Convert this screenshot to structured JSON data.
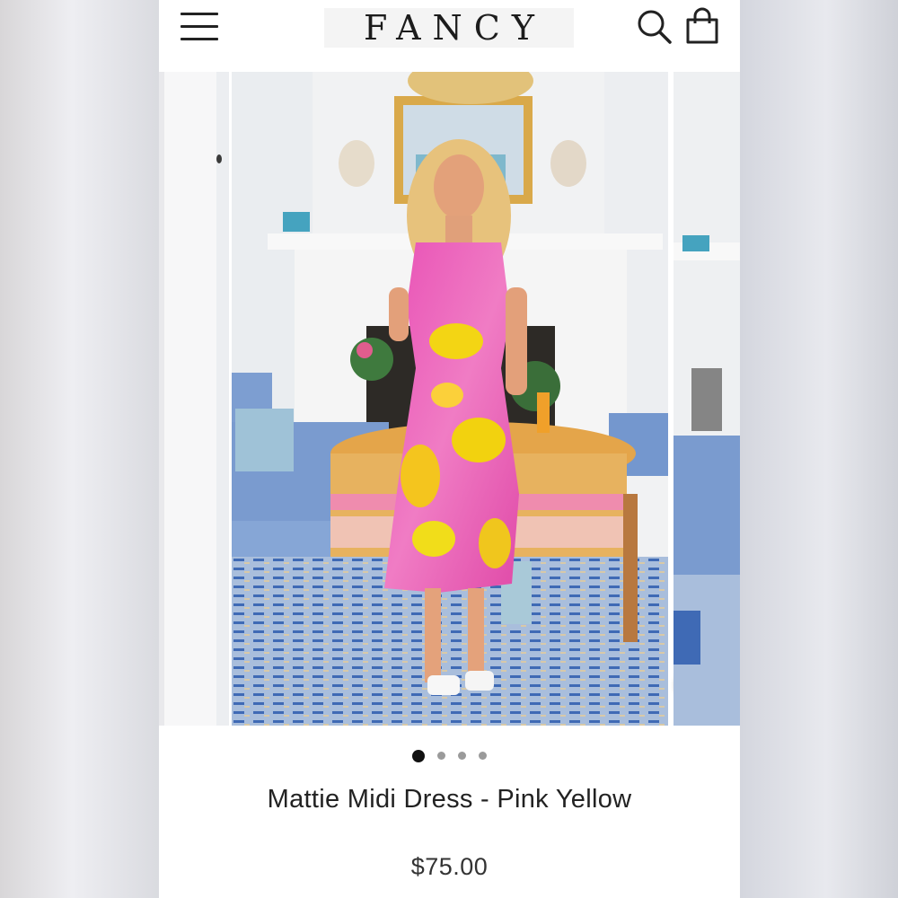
{
  "header": {
    "brand": "FANCY",
    "menu_icon": "hamburger-menu-icon",
    "search_icon": "search-icon",
    "cart_icon": "shopping-bag-icon"
  },
  "gallery": {
    "image_alt": "Woman wearing a pink and yellow floral midi dress standing in a sunroom",
    "zoom_icon": "zoom-icon",
    "slide_count": 4,
    "active_slide": 1
  },
  "product": {
    "title": "Mattie Midi Dress - Pink Yellow",
    "price": "$75.00"
  },
  "colors": {
    "dress_pink": "#e64ab1",
    "dress_yellow": "#f2d20f",
    "sofa_blue": "#7a9bcf",
    "rug_blue": "#4f78be"
  }
}
